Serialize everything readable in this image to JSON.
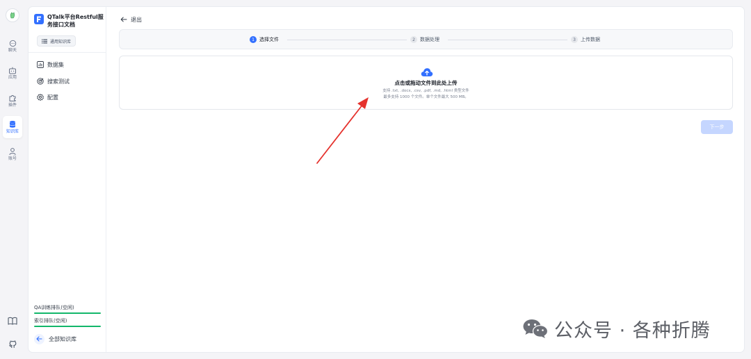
{
  "rail": {
    "items": [
      {
        "label": "聊天",
        "icon": "chat-icon"
      },
      {
        "label": "应用",
        "icon": "robot-icon"
      },
      {
        "label": "插件",
        "icon": "plugin-icon"
      },
      {
        "label": "知识库",
        "icon": "database-icon",
        "active": true
      },
      {
        "label": "账号",
        "icon": "user-icon"
      }
    ],
    "bottom": [
      {
        "icon": "book-icon"
      },
      {
        "icon": "github-icon"
      }
    ]
  },
  "kb": {
    "title": "QTalk平台Restful服务接口文档",
    "type_label": "通用知识库",
    "nav": [
      {
        "label": "数据集",
        "icon": "bar-chart-icon"
      },
      {
        "label": "搜索测试",
        "icon": "target-icon"
      },
      {
        "label": "配置",
        "icon": "gear-icon"
      }
    ],
    "queues": [
      {
        "label": "QA训练排队(空闲)",
        "progress": 1.0
      },
      {
        "label": "索引排队(空闲)",
        "progress": 1.0
      }
    ],
    "all_label": "全部知识库"
  },
  "main": {
    "back_label": "退出",
    "steps": [
      {
        "num": "1",
        "label": "选择文件",
        "active": true
      },
      {
        "num": "2",
        "label": "数据处理",
        "active": false
      },
      {
        "num": "3",
        "label": "上传数据",
        "active": false
      }
    ],
    "upload": {
      "title": "点击或拖动文件到此处上传",
      "tip1": "支持 .txt, .docx, .csv, .pdf, .md, .html 类型文件",
      "tip2": "最多支持 1000 个文件。单个文件最大 500 MB。"
    },
    "next_label": "下一步"
  },
  "watermark": "公众号 · 各种折腾",
  "colors": {
    "accent": "#3370ff",
    "progress": "#12b76a",
    "annotation": "#e5322d",
    "disabled_button": "#c5d6ff"
  }
}
